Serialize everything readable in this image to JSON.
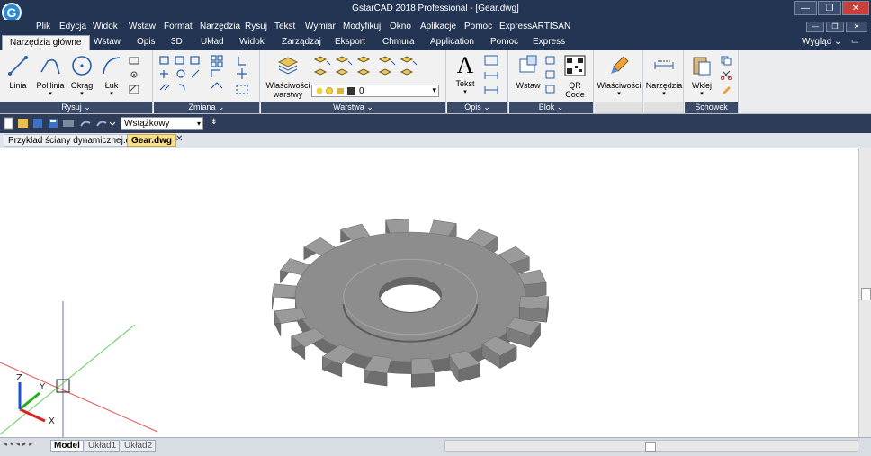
{
  "window": {
    "title": "GstarCAD 2018 Professional - [Gear.dwg]",
    "logo_letter": "G",
    "buttons": {
      "minimize": "—",
      "restore": "❐",
      "close": "✕"
    },
    "inner_buttons": {
      "minimize": "—",
      "restore": "❐",
      "close": "✕"
    }
  },
  "menu": [
    "Plik",
    "Edycja",
    "Widok",
    "Wstaw",
    "Format",
    "Narzędzia",
    "Rysuj",
    "Tekst",
    "Wymiar",
    "Modyfikuj",
    "Okno",
    "Aplikacje",
    "Pomoc",
    "Express",
    "ARTISAN"
  ],
  "tabs": [
    "Narzędzia główne",
    "Wstaw",
    "Opis",
    "3D",
    "Układ",
    "Widok",
    "Zarządzaj",
    "Eksport",
    "Chmura",
    "Application",
    "Pomoc",
    "Express"
  ],
  "workspace_label": "Wygląd",
  "ribbon": {
    "draw": {
      "title": "Rysuj",
      "line": "Linia",
      "polyline": "Polilinia",
      "circle": "Okrąg",
      "arc": "Łuk"
    },
    "modify": {
      "title": "Zmiana"
    },
    "layers": {
      "title": "Warstwa",
      "properties": "Właściwości",
      "properties2": "warstwy",
      "current_layer": "0"
    },
    "annotation": {
      "title": "Opis",
      "text": "Tekst"
    },
    "block": {
      "title": "Blok",
      "insert": "Wstaw",
      "qr": "QR",
      "qr2": "Code"
    },
    "properties": {
      "label": "Właściwości"
    },
    "utilities": {
      "label": "Narzędzia"
    },
    "clipboard": {
      "title": "Schowek",
      "paste": "Wklej"
    }
  },
  "qat": {
    "workspace": "Wstążkowy"
  },
  "documents": [
    "Przykład ściany dynamicznej.dwg",
    "Gear.dwg"
  ],
  "active_document": "Gear.dwg",
  "ucs": {
    "x": "X",
    "y": "Y",
    "z": "Z"
  },
  "layouts": [
    "Model",
    "Układ1",
    "Układ2"
  ],
  "colors": {
    "title_bar": "#243553",
    "ribbon_bg": "#f1f1f1",
    "panel_footer": "#3a4a67",
    "active_doc_tab": "#f8df8a",
    "gear": "#8a8a8a"
  }
}
